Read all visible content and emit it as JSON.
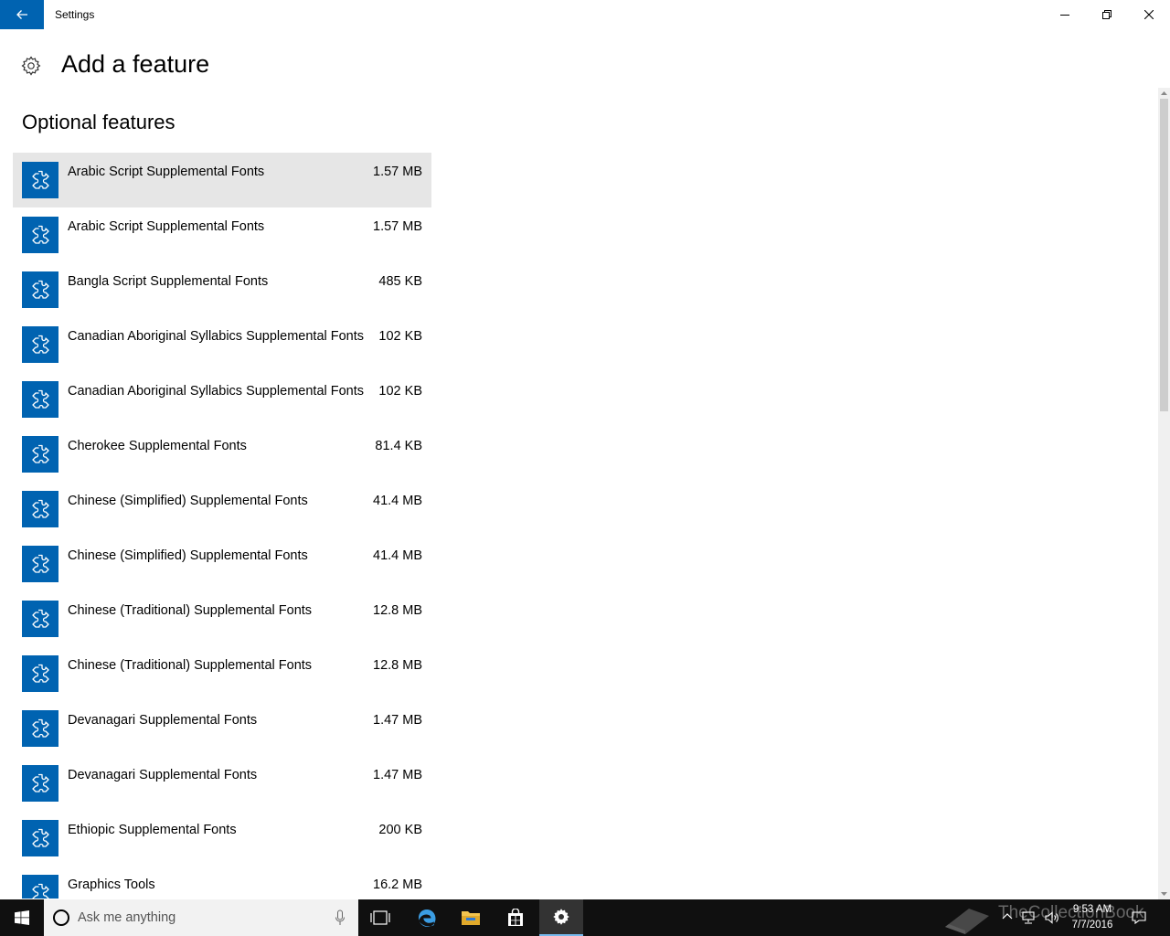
{
  "window": {
    "title": "Settings",
    "back_icon": "arrow-left-icon",
    "minimize_icon": "minimize-icon",
    "restore_icon": "restore-icon",
    "close_icon": "close-icon"
  },
  "header": {
    "icon": "gear-icon",
    "title": "Add a feature"
  },
  "section": {
    "title": "Optional features"
  },
  "features": [
    {
      "name": "Arabic Script Supplemental Fonts",
      "size": "1.57 MB"
    },
    {
      "name": "Arabic Script Supplemental Fonts",
      "size": "1.57 MB"
    },
    {
      "name": "Bangla Script Supplemental Fonts",
      "size": "485 KB"
    },
    {
      "name": "Canadian Aboriginal Syllabics Supplemental Fonts",
      "size": "102 KB"
    },
    {
      "name": "Canadian Aboriginal Syllabics Supplemental Fonts",
      "size": "102 KB"
    },
    {
      "name": "Cherokee Supplemental Fonts",
      "size": "81.4 KB"
    },
    {
      "name": "Chinese (Simplified) Supplemental Fonts",
      "size": "41.4 MB"
    },
    {
      "name": "Chinese (Simplified) Supplemental Fonts",
      "size": "41.4 MB"
    },
    {
      "name": "Chinese (Traditional) Supplemental Fonts",
      "size": "12.8 MB"
    },
    {
      "name": "Chinese (Traditional) Supplemental Fonts",
      "size": "12.8 MB"
    },
    {
      "name": "Devanagari Supplemental Fonts",
      "size": "1.47 MB"
    },
    {
      "name": "Devanagari Supplemental Fonts",
      "size": "1.47 MB"
    },
    {
      "name": "Ethiopic Supplemental Fonts",
      "size": "200 KB"
    },
    {
      "name": "Graphics Tools",
      "size": "16.2 MB"
    }
  ],
  "selected_index": 0,
  "feature_icon": "puzzle-piece-icon",
  "colors": {
    "accent": "#0063b1",
    "selected_row": "#e6e6e6",
    "taskbar": "#101010"
  },
  "taskbar": {
    "search_placeholder": "Ask me anything",
    "watermark": "TheCollectionBook",
    "time": "9:53 AM",
    "date": "7/7/2016"
  }
}
